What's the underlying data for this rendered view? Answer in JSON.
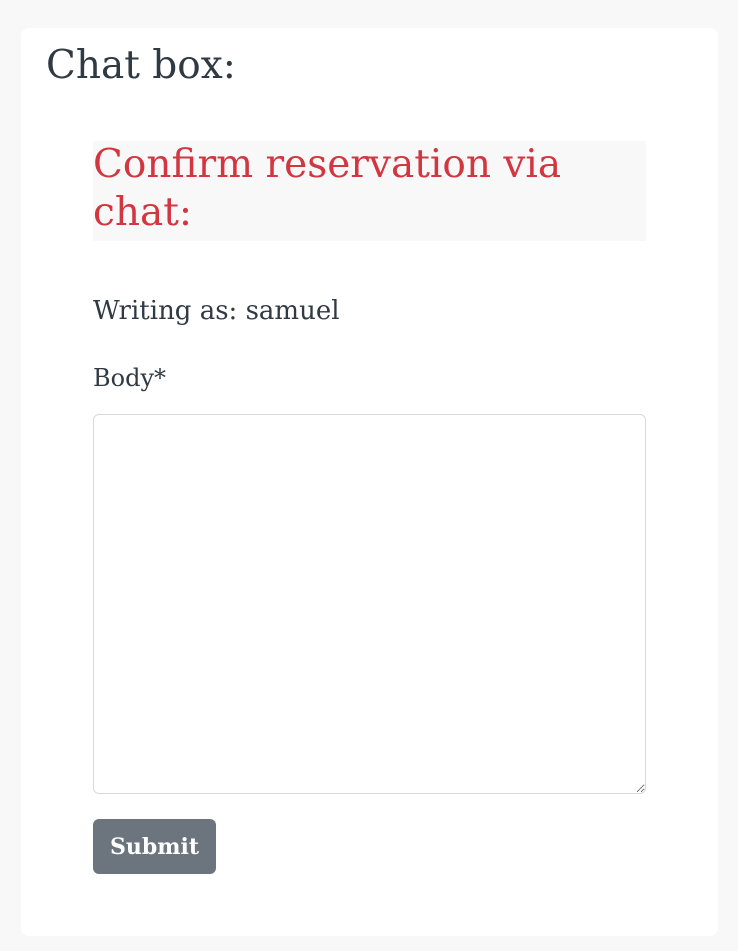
{
  "chat_box": {
    "title": "Chat box:",
    "confirm_heading": "Confirm reservation via chat:",
    "writing_as": "Writing as: samuel",
    "body_label": "Body*",
    "body_value": "",
    "submit_label": "Submit"
  },
  "colors": {
    "page_background": "#f8f8f8",
    "card_background": "#ffffff",
    "heading_text": "#2f3a44",
    "confirm_heading_text": "#d13641",
    "submit_background": "#6c757d",
    "submit_text": "#ffffff"
  }
}
